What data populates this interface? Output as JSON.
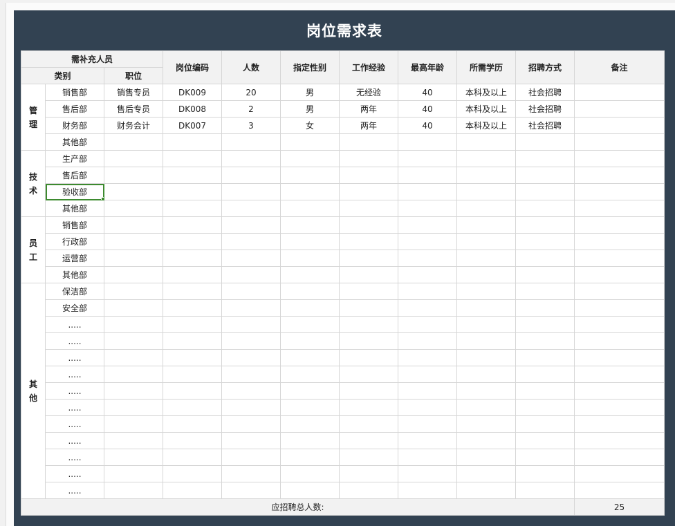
{
  "title": "岗位需求表",
  "headers": {
    "group": "需补充人员",
    "category": "类别",
    "position": "职位",
    "code": "岗位编码",
    "count": "人数",
    "gender": "指定性别",
    "experience": "工作经验",
    "max_age": "最高年龄",
    "education": "所需学历",
    "recruit_method": "招聘方式",
    "remarks": "备注"
  },
  "categories": [
    {
      "label": "管\n理",
      "rows": [
        {
          "dept": "销售部",
          "position": "销售专员",
          "code": "DK009",
          "count": "20",
          "gender": "男",
          "experience": "无经验",
          "max_age": "40",
          "education": "本科及以上",
          "method": "社会招聘",
          "remarks": ""
        },
        {
          "dept": "售后部",
          "position": "售后专员",
          "code": "DK008",
          "count": "2",
          "gender": "男",
          "experience": "两年",
          "max_age": "40",
          "education": "本科及以上",
          "method": "社会招聘",
          "remarks": ""
        },
        {
          "dept": "财务部",
          "position": "财务会计",
          "code": "DK007",
          "count": "3",
          "gender": "女",
          "experience": "两年",
          "max_age": "40",
          "education": "本科及以上",
          "method": "社会招聘",
          "remarks": ""
        },
        {
          "dept": "其他部"
        }
      ]
    },
    {
      "label": "技\n术",
      "rows": [
        {
          "dept": "生产部"
        },
        {
          "dept": "售后部"
        },
        {
          "dept": "验收部",
          "selected": true
        },
        {
          "dept": "其他部"
        }
      ]
    },
    {
      "label": "员\n工",
      "rows": [
        {
          "dept": "销售部"
        },
        {
          "dept": "行政部"
        },
        {
          "dept": "运营部"
        },
        {
          "dept": "其他部"
        }
      ]
    },
    {
      "label": "其\n他",
      "rows": [
        {
          "dept": "保洁部"
        },
        {
          "dept": "安全部"
        },
        {
          "dept": "....."
        },
        {
          "dept": "....."
        },
        {
          "dept": "....."
        },
        {
          "dept": "....."
        },
        {
          "dept": "....."
        },
        {
          "dept": "....."
        },
        {
          "dept": "....."
        },
        {
          "dept": "....."
        },
        {
          "dept": "....."
        },
        {
          "dept": "....."
        },
        {
          "dept": "....."
        }
      ]
    }
  ],
  "footer": {
    "label": "应招聘总人数:",
    "total": "25"
  }
}
